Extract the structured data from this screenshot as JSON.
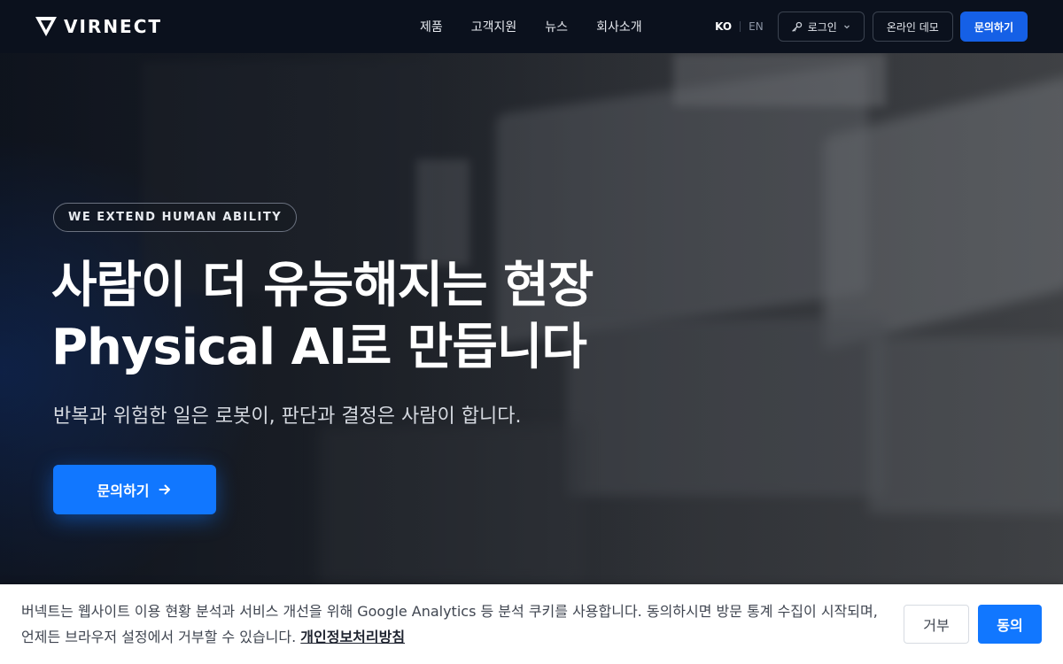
{
  "header": {
    "logo_text": "VIRNECT",
    "nav": [
      "제품",
      "고객지원",
      "뉴스",
      "회사소개"
    ],
    "lang_ko": "KO",
    "lang_en": "EN",
    "login_label": "로그인",
    "demo_label": "온라인 데모",
    "contact_label": "문의하기"
  },
  "hero": {
    "badge": "WE EXTEND HUMAN ABILITY",
    "title_line1": "사람이 더 유능해지는 현장",
    "title_line2": "Physical AI로 만듭니다",
    "subtitle": "반복과 위험한 일은 로봇이, 판단과 결정은 사람이 합니다.",
    "cta_label": "문의하기"
  },
  "cookie": {
    "text": "버넥트는 웹사이트 이용 현황 분석과 서비스 개선을 위해 Google Analytics 등 분석 쿠키를 사용합니다. 동의하시면 방문 통계 수집이 시작되며, 언제든 브라우저 설정에서 거부할 수 있습니다.",
    "link_label": "개인정보처리방침",
    "reject_label": "거부",
    "accept_label": "동의"
  },
  "colors": {
    "header_bg": "#0b111d",
    "primary": "#1177ff",
    "primary_dark": "#1560e6"
  },
  "icons": [
    "virnect-logo-icon",
    "key-icon",
    "chevron-down-icon",
    "arrow-right-icon"
  ]
}
